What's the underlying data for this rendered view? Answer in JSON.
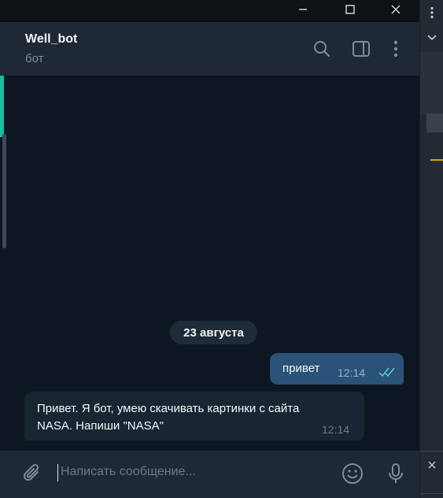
{
  "window": {
    "minimize_icon": "minimize-icon",
    "maximize_icon": "maximize-icon",
    "close_icon": "close-icon"
  },
  "header": {
    "title": "Well_bot",
    "status": "бот",
    "icons": [
      "search-icon",
      "side-panel-icon",
      "more-vertical-icon"
    ]
  },
  "messages": {
    "date_separator": "23 августа",
    "items": [
      {
        "direction": "outgoing",
        "text": "привет",
        "time": "12:14",
        "read": true
      },
      {
        "direction": "incoming",
        "text": "Привет. Я бот, умею скачивать картинки с сайта NASA. Напиши \"NASA\"",
        "time": "12:14"
      }
    ]
  },
  "composer": {
    "placeholder": "Написать сообщение...",
    "value": "",
    "icons": [
      "attach-icon",
      "emoji-icon",
      "microphone-icon"
    ]
  },
  "colors": {
    "header_bg": "#1f2936",
    "messages_bg": "#0e1621",
    "outgoing_bubble": "#2b5278",
    "incoming_bubble": "#182533",
    "read_ticks": "#4fd6c0",
    "accent": "#15c0a6"
  }
}
